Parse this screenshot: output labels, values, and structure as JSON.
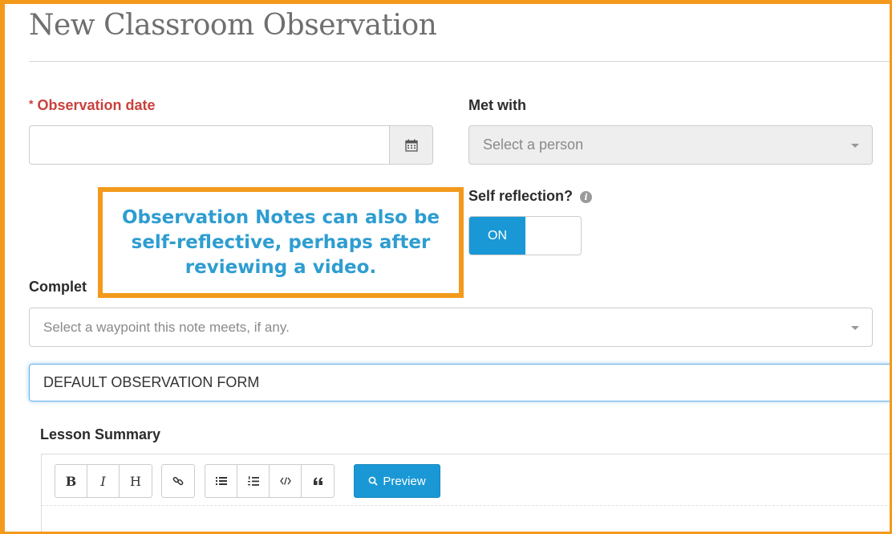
{
  "page": {
    "title": "New Classroom Observation"
  },
  "fields": {
    "observation_date": {
      "label": "Observation date",
      "required_marker": "*",
      "value": ""
    },
    "met_with": {
      "label": "Met with",
      "placeholder": "Select a person"
    },
    "self_reflection": {
      "label": "Self reflection?",
      "toggle_label": "ON",
      "state": "on"
    },
    "completes": {
      "label_visible": "Complet",
      "placeholder": "Select a waypoint this note meets, if any."
    },
    "form_template": {
      "value": "DEFAULT OBSERVATION FORM"
    }
  },
  "callout": {
    "text": "Observation Notes can also be\nself-reflective, perhaps after\nreviewing a video."
  },
  "lesson_summary": {
    "label": "Lesson Summary",
    "toolbar": {
      "bold": "B",
      "italic": "I",
      "heading": "H",
      "preview": "Preview"
    }
  },
  "icons": [
    "calendar-icon",
    "info-icon",
    "link-icon",
    "bullet-list-icon",
    "numbered-list-icon",
    "code-icon",
    "quote-icon",
    "search-icon",
    "caret-down-icon"
  ],
  "colors": {
    "accent": "#1a98d5",
    "required": "#c9413c",
    "callout_border": "#f39a1c",
    "callout_text": "#2e9dd1"
  }
}
